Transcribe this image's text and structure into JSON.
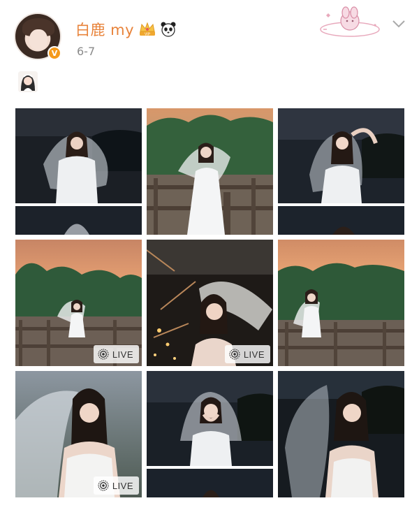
{
  "post": {
    "username": "白鹿 my",
    "date": "6-7",
    "verified_badge": "V",
    "icons": {
      "verified": "verified-v-icon",
      "crown": "crown-icon",
      "panda": "panda-icon",
      "expand": "chevron-down-icon"
    }
  },
  "colors": {
    "username": "#e8833a",
    "date": "#8a8a8a",
    "verified_badge": "#f59a1b"
  },
  "photos": [
    {
      "scene": "night-veil",
      "live": false
    },
    {
      "scene": "sunset-fence-veil",
      "live": false
    },
    {
      "scene": "night-hand-on-head",
      "live": false
    },
    {
      "scene": "sunset-fence-wide",
      "live": true,
      "live_label": "LIVE"
    },
    {
      "scene": "night-lights-veil",
      "live": true,
      "live_label": "LIVE"
    },
    {
      "scene": "sunset-fence-wide-2",
      "live": false
    },
    {
      "scene": "dusk-portrait",
      "live": true,
      "live_label": "LIVE"
    },
    {
      "scene": "night-hands-on-face",
      "live": false
    },
    {
      "scene": "night-flowing-veil",
      "live": false
    }
  ]
}
